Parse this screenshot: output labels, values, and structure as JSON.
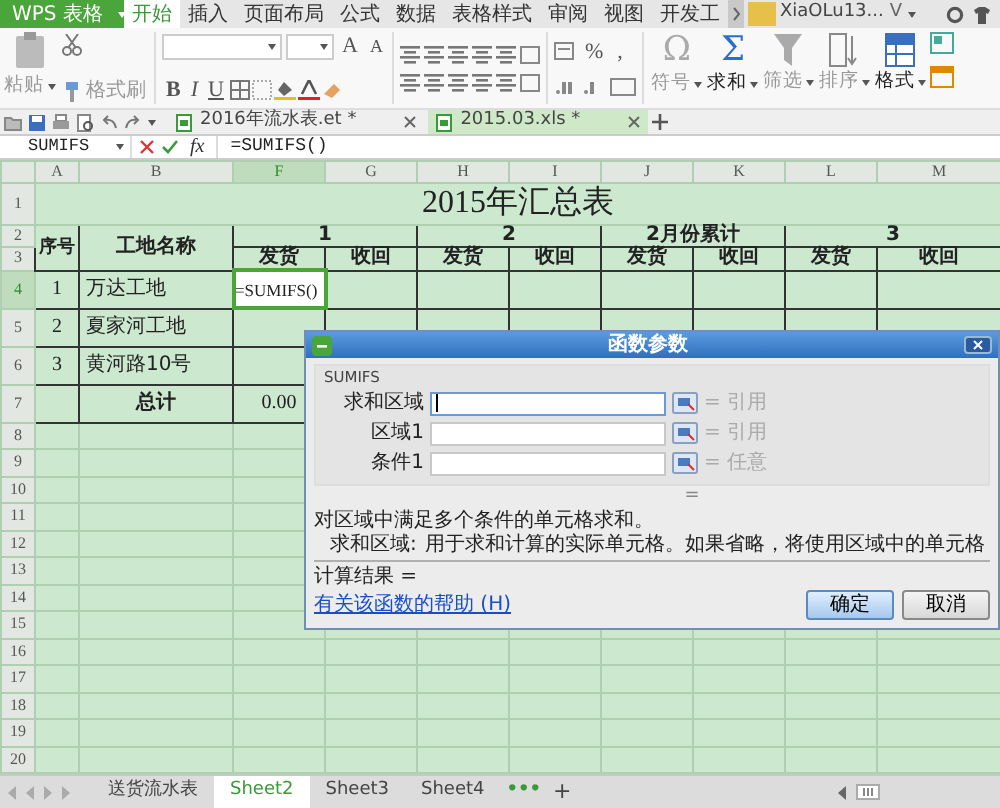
{
  "app_button": {
    "label": "WPS 表格"
  },
  "menu_tabs": [
    {
      "label": "开始",
      "selected": true
    },
    {
      "label": "插入",
      "selected": false
    },
    {
      "label": "页面布局",
      "selected": false
    },
    {
      "label": "公式",
      "selected": false
    },
    {
      "label": "数据",
      "selected": false
    },
    {
      "label": "表格样式",
      "selected": false
    },
    {
      "label": "审阅",
      "selected": false
    },
    {
      "label": "视图",
      "selected": false
    },
    {
      "label": "开发工",
      "selected": false
    }
  ],
  "user": {
    "name": "XiaOLu13...",
    "badge": "V"
  },
  "ribbon": {
    "clipboard": [
      {
        "label": "粘贴",
        "disabled": true
      },
      {
        "label": "格式刷",
        "disabled": true
      }
    ],
    "font_size_buttons": [
      "A",
      "A"
    ],
    "font_styles": [
      "B",
      "I",
      "U"
    ],
    "number_symbols": [
      "%",
      ","
    ],
    "tools": [
      {
        "label": "符号",
        "glyph": "Ω",
        "disabled": true,
        "dropdown": true
      },
      {
        "label": "求和",
        "glyph": "Σ",
        "disabled": false,
        "dropdown": true
      },
      {
        "label": "筛选",
        "kind": "filter",
        "disabled": true,
        "dropdown": true
      },
      {
        "label": "排序",
        "kind": "sort",
        "disabled": true,
        "dropdown": true
      },
      {
        "label": "格式",
        "kind": "format",
        "disabled": false,
        "dropdown": true
      }
    ]
  },
  "doc_tabs": [
    {
      "label": "2016年流水表.et *",
      "selected": false
    },
    {
      "label": "2015.03.xls *",
      "selected": true
    }
  ],
  "formula_bar": {
    "name_box": "SUMIFS",
    "fx": "fx",
    "formula": "=SUMIFS()"
  },
  "sheet": {
    "columns": [
      {
        "label": "A",
        "selected": false
      },
      {
        "label": "B",
        "selected": false
      },
      {
        "label": "F",
        "selected": true
      },
      {
        "label": "G",
        "selected": false
      },
      {
        "label": "H",
        "selected": false
      },
      {
        "label": "I",
        "selected": false
      },
      {
        "label": "J",
        "selected": false
      },
      {
        "label": "K",
        "selected": false
      },
      {
        "label": "L",
        "selected": false
      },
      {
        "label": "M",
        "selected": false
      }
    ],
    "row_numbers": [
      {
        "label": "1",
        "selected": false
      },
      {
        "label": "2",
        "selected": false
      },
      {
        "label": "3",
        "selected": false
      },
      {
        "label": "4",
        "selected": true
      },
      {
        "label": "5",
        "selected": false
      },
      {
        "label": "6",
        "selected": false
      },
      {
        "label": "7",
        "selected": false
      },
      {
        "label": "8",
        "selected": false
      },
      {
        "label": "9",
        "selected": false
      },
      {
        "label": "10",
        "selected": false
      },
      {
        "label": "11",
        "selected": false
      },
      {
        "label": "12",
        "selected": false
      },
      {
        "label": "13",
        "selected": false
      },
      {
        "label": "14",
        "selected": false
      },
      {
        "label": "15",
        "selected": false
      },
      {
        "label": "16",
        "selected": false
      },
      {
        "label": "17",
        "selected": false
      },
      {
        "label": "18",
        "selected": false
      },
      {
        "label": "19",
        "selected": false
      },
      {
        "label": "20",
        "selected": false
      }
    ],
    "title": "2015年汇总表",
    "header": {
      "index": "序号",
      "site": "工地名称",
      "groups": [
        "1",
        "2",
        "2月份累计",
        "3"
      ],
      "subheaders": [
        "发货",
        "收回",
        "发货",
        "收回",
        "发货",
        "收回",
        "发货",
        "收回"
      ]
    },
    "rows": [
      {
        "index": "1",
        "site": "万达工地",
        "values": [
          {
            "text": "=SUMIFS()",
            "selected": true
          }
        ]
      },
      {
        "index": "2",
        "site": "夏家河工地"
      },
      {
        "index": "3",
        "site": "黄河路10号"
      }
    ],
    "total": {
      "label": "总计",
      "values": [
        {
          "text": "0.00",
          "selected": false
        }
      ]
    }
  },
  "dialog": {
    "title": "函数参数",
    "function": "SUMIFS",
    "args": [
      {
        "label": "求和区域",
        "hint": "= 引用",
        "focused": true
      },
      {
        "label": "区域1",
        "hint": "= 引用",
        "focused": false
      },
      {
        "label": "条件1",
        "hint": "= 任意",
        "focused": false
      }
    ],
    "result_eq": "=",
    "description": "对区域中满足多个条件的单元格求和。",
    "arg_help": {
      "label": "求和区域:",
      "text": "用于求和计算的实际单元格。如果省略，将使用区域中的单元格"
    },
    "result_label": "计算结果 =",
    "help_link": "有关该函数的帮助 (H)",
    "buttons": [
      {
        "label": "确定",
        "kind": "primary"
      },
      {
        "label": "取消",
        "kind": "secondary"
      }
    ]
  },
  "sheet_tabs": [
    {
      "label": "送货流水表",
      "selected": false
    },
    {
      "label": "Sheet2",
      "selected": true
    },
    {
      "label": "Sheet3",
      "selected": false
    },
    {
      "label": "Sheet4",
      "selected": false
    }
  ],
  "sheet_more": "•••",
  "sheet_add": "+"
}
